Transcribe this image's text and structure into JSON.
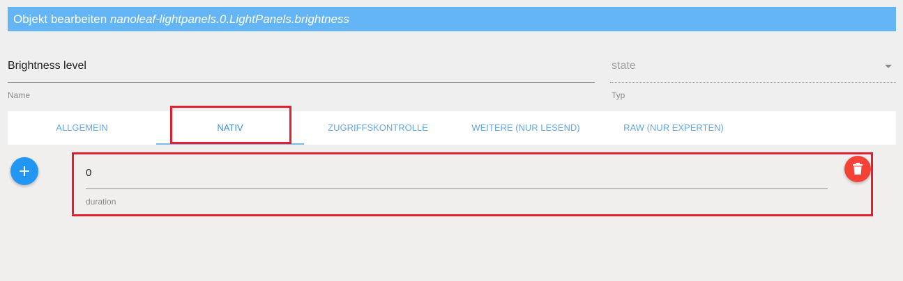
{
  "dialog": {
    "title_prefix": "Objekt bearbeiten ",
    "object_id": "nanoleaf-lightpanels.0.LightPanels.brightness"
  },
  "fields": {
    "name": {
      "value": "Brightness level",
      "label": "Name"
    },
    "type": {
      "value": "state",
      "label": "Typ"
    }
  },
  "tabs": [
    {
      "label": "ALLGEMEIN"
    },
    {
      "label": "NATIV",
      "active": true
    },
    {
      "label": "ZUGRIFFSKONTROLLE"
    },
    {
      "label": "WEITERE (NUR LESEND)"
    },
    {
      "label": "RAW (NUR EXPERTEN)"
    }
  ],
  "native": {
    "duration": {
      "value": "0",
      "label": "duration"
    }
  },
  "icons": {
    "add": "plus-icon",
    "delete": "trash-icon",
    "dropdown": "caret-down-icon"
  },
  "colors": {
    "title_bar": "#64b5f6",
    "tab_text": "#64a8ea",
    "add_button": "#2196f3",
    "delete_button": "#f44336",
    "highlight": "#e5202e"
  }
}
